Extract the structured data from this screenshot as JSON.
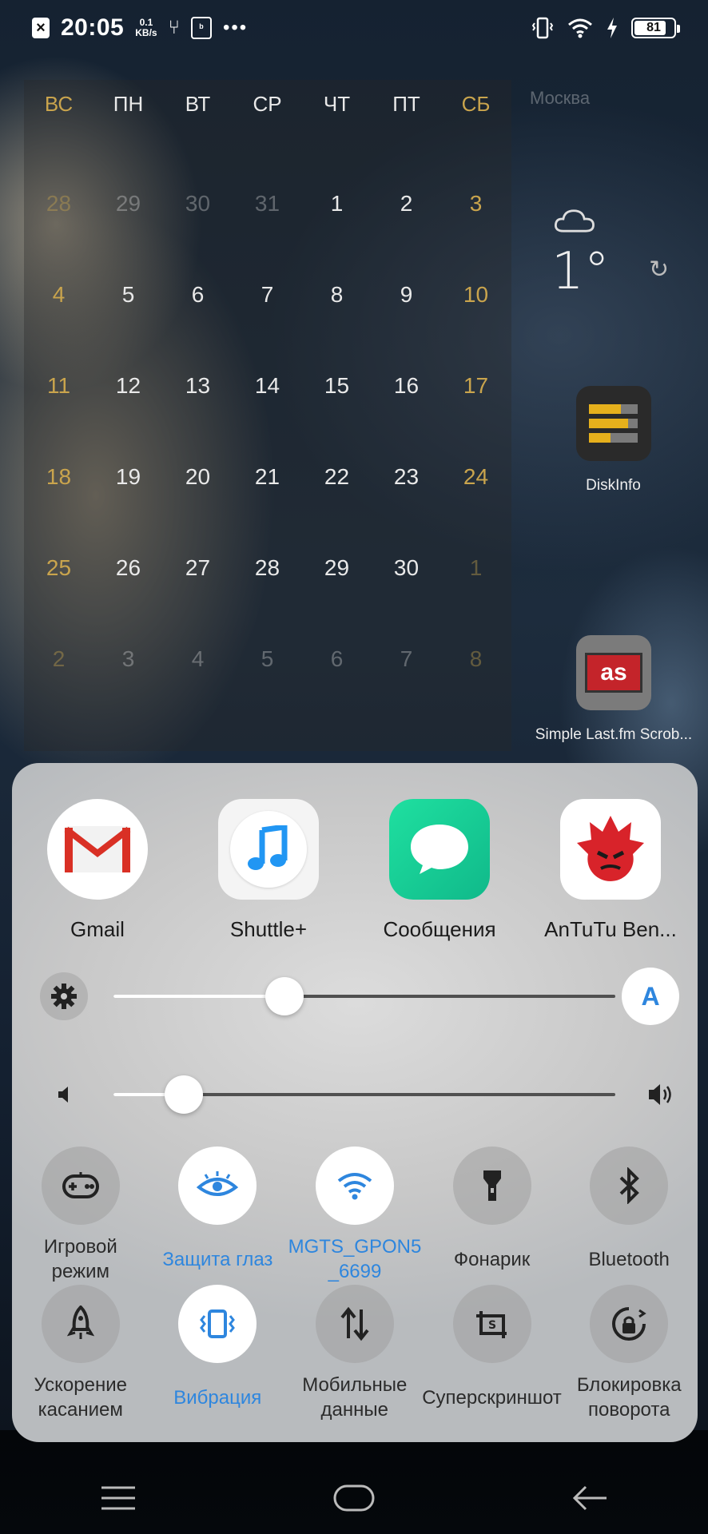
{
  "status_bar": {
    "time": "20:05",
    "speed_value": "0.1",
    "speed_unit": "KB/s",
    "battery": "81",
    "battery_level": 0.81
  },
  "calendar": {
    "weekdays": [
      "ВС",
      "ПН",
      "ВТ",
      "СР",
      "ЧТ",
      "ПТ",
      "СБ"
    ],
    "weeks": [
      [
        "28",
        "29",
        "30",
        "31",
        "1",
        "2",
        "3"
      ],
      [
        "4",
        "5",
        "6",
        "7",
        "8",
        "9",
        "10"
      ],
      [
        "11",
        "12",
        "13",
        "14",
        "15",
        "16",
        "17"
      ],
      [
        "18",
        "19",
        "20",
        "21",
        "22",
        "23",
        "24"
      ],
      [
        "25",
        "26",
        "27",
        "28",
        "29",
        "30",
        "1"
      ],
      [
        "2",
        "3",
        "4",
        "5",
        "6",
        "7",
        "8"
      ]
    ],
    "weekend_color": "#c9a44d"
  },
  "widget_label": "Москва",
  "weather": {
    "temperature": "1°",
    "icon": "cloud-icon"
  },
  "home_apps": [
    {
      "label": "DiskInfo",
      "icon": "diskinfo-icon"
    },
    {
      "label": "Simple Last.fm Scrob...",
      "icon": "lastfm-icon"
    }
  ],
  "quick_panel": {
    "apps": [
      {
        "label": "Gmail",
        "icon": "gmail-icon"
      },
      {
        "label": "Shuttle+",
        "icon": "shuttle-icon"
      },
      {
        "label": "Сообщения",
        "icon": "messages-icon"
      },
      {
        "label": "AnTuTu Ben...",
        "icon": "antutu-icon"
      }
    ],
    "brightness": {
      "level": 0.34,
      "auto_label": "A"
    },
    "volume": {
      "level": 0.14
    },
    "toggles_row1": [
      {
        "label": "Игровой режим",
        "icon": "gamepad-icon",
        "active": false
      },
      {
        "label": "Защита глаз",
        "icon": "eye-icon",
        "active": true
      },
      {
        "label": "MGTS_GPON5_6699",
        "icon": "wifi-icon",
        "active": true
      },
      {
        "label": "Фонарик",
        "icon": "flashlight-icon",
        "active": false
      },
      {
        "label": "Bluetooth",
        "icon": "bluetooth-icon",
        "active": false
      }
    ],
    "toggles_row2": [
      {
        "label": "Ускорение касанием",
        "icon": "rocket-icon",
        "active": false
      },
      {
        "label": "Вибрация",
        "icon": "vibration-icon",
        "active": true
      },
      {
        "label": "Мобильные данные",
        "icon": "mobile-data-icon",
        "active": false
      },
      {
        "label": "Суперскриншот",
        "icon": "screenshot-icon",
        "active": false
      },
      {
        "label": "Блокировка поворота",
        "icon": "rotation-lock-icon",
        "active": false
      }
    ],
    "active_color": "#2e86de"
  }
}
